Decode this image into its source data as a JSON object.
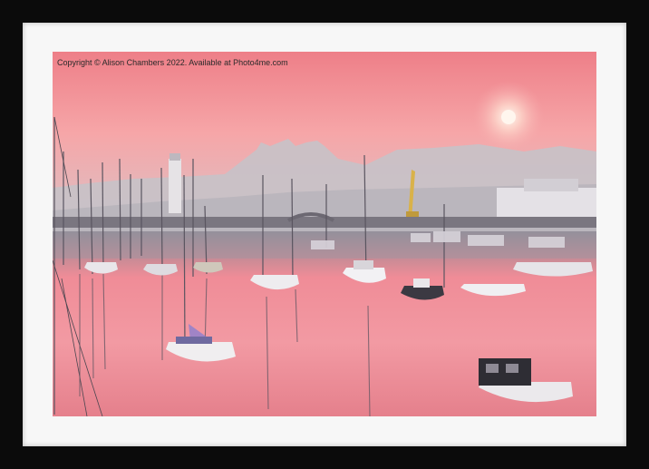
{
  "photo": {
    "copyright": "Copyright © Alison Chambers 2022. Available at Photo4me.com",
    "colors": {
      "frame": "#0b0b0b",
      "mount": "#f7f7f7",
      "sky_top": "#ef7f86",
      "sky_mid": "#f4a7a9",
      "haze": "#c9c6cc",
      "water_pink": "#ee8894",
      "water_dark": "#3a3a44",
      "sun": "#fff4ea"
    }
  }
}
